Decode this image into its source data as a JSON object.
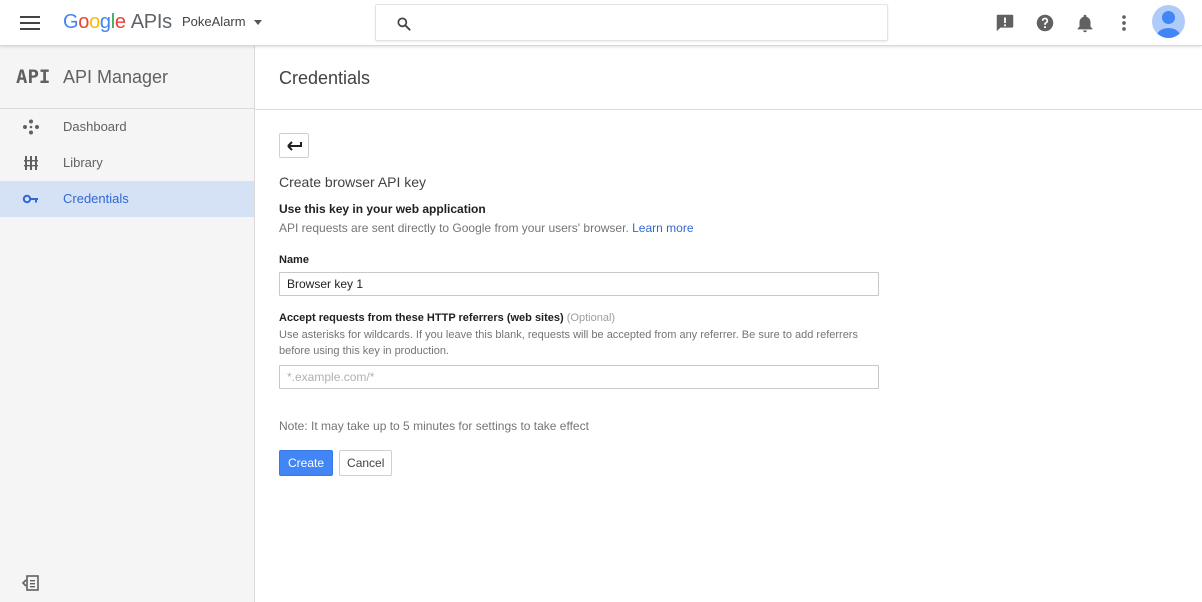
{
  "header": {
    "logo_parts": [
      "G",
      "o",
      "o",
      "g",
      "l",
      "e"
    ],
    "logo_suffix": "APIs",
    "project_name": "PokeAlarm",
    "search_placeholder": ""
  },
  "sidebar": {
    "logo_text": "API",
    "title": "API Manager",
    "items": [
      {
        "label": "Dashboard",
        "icon": "dashboard-icon",
        "active": false
      },
      {
        "label": "Library",
        "icon": "library-icon",
        "active": false
      },
      {
        "label": "Credentials",
        "icon": "key-icon",
        "active": true
      }
    ]
  },
  "main": {
    "page_title": "Credentials",
    "form_title": "Create browser API key",
    "subtitle": "Use this key in your web application",
    "description": "API requests are sent directly to Google from your users' browser.",
    "learn_more": "Learn more",
    "name_label": "Name",
    "name_value": "Browser key 1",
    "referrers_label": "Accept requests from these HTTP referrers (web sites)",
    "referrers_optional": "(Optional)",
    "referrers_help": "Use asterisks for wildcards. If you leave this blank, requests will be accepted from any referrer. Be sure to add referrers before using this key in production.",
    "referrers_placeholder": "*.example.com/*",
    "note": "Note: It may take up to 5 minutes for settings to take effect",
    "create_label": "Create",
    "cancel_label": "Cancel"
  },
  "colors": {
    "accent": "#4285f4",
    "active_nav_bg": "#d5e2f6",
    "active_nav_text": "#3367d6"
  }
}
